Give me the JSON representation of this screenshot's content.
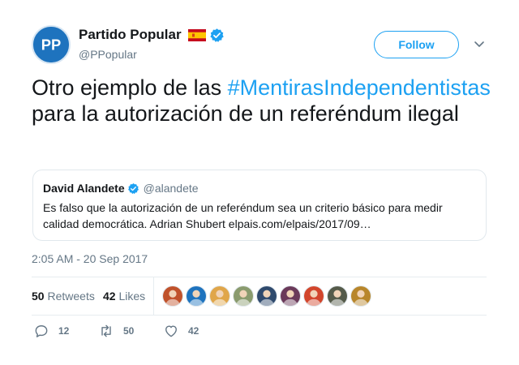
{
  "author": {
    "display_name": "Partido Popular",
    "handle": "@PPopular",
    "avatar_text": "PP",
    "verified": true,
    "flag": "spain-flag-icon"
  },
  "follow_button": {
    "label": "Follow"
  },
  "tweet": {
    "text_before": "Otro ejemplo de las ",
    "hashtag": "#MentirasIndependentistas",
    "text_after": " para la autorización de un referéndum ilegal"
  },
  "quoted_tweet": {
    "name": "David Alandete",
    "handle": "@alandete",
    "verified": true,
    "text": "Es falso que la autorización de un referéndum sea un criterio básico para medir calidad democrática. Adrian Shubert elpais.com/elpais/2017/09…"
  },
  "timestamp": "2:05 AM - 20 Sep 2017",
  "stats": {
    "retweets_count": "50",
    "retweets_label": "Retweets",
    "likes_count": "42",
    "likes_label": "Likes"
  },
  "likers": [
    {
      "name": "liker-avatar-1",
      "color": "#c0522b"
    },
    {
      "name": "liker-avatar-2",
      "color": "#1e73be"
    },
    {
      "name": "liker-avatar-3",
      "color": "#e0a64a"
    },
    {
      "name": "liker-avatar-4",
      "color": "#8a9b6e"
    },
    {
      "name": "liker-avatar-5",
      "color": "#2f4a6d"
    },
    {
      "name": "liker-avatar-6",
      "color": "#6b3a5a"
    },
    {
      "name": "liker-avatar-7",
      "color": "#d2462c"
    },
    {
      "name": "liker-avatar-8",
      "color": "#555b4a"
    },
    {
      "name": "liker-avatar-9",
      "color": "#b8862b"
    }
  ],
  "actions": {
    "replies": "12",
    "retweets": "50",
    "likes": "42"
  },
  "colors": {
    "accent": "#1da1f2",
    "text": "#14171a",
    "secondary": "#657786",
    "border": "#e6ecf0"
  }
}
